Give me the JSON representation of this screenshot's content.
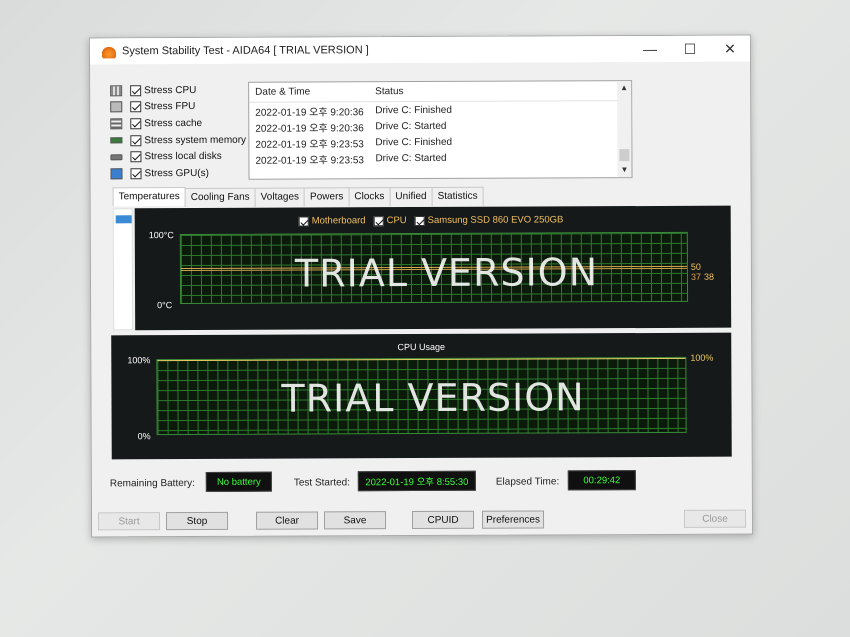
{
  "window": {
    "title": "System Stability Test - AIDA64  [ TRIAL VERSION ]",
    "controls": {
      "minimize": "—",
      "maximize": "☐",
      "close": "✕"
    }
  },
  "stress_options": [
    {
      "label": "Stress CPU",
      "icon": "cpu-icon",
      "checked": true
    },
    {
      "label": "Stress FPU",
      "icon": "fpu-icon",
      "checked": true
    },
    {
      "label": "Stress cache",
      "icon": "cache-icon",
      "checked": true
    },
    {
      "label": "Stress system memory",
      "icon": "memory-icon",
      "checked": true
    },
    {
      "label": "Stress local disks",
      "icon": "disk-icon",
      "checked": true
    },
    {
      "label": "Stress GPU(s)",
      "icon": "gpu-icon",
      "checked": true
    }
  ],
  "status_log": {
    "headers": {
      "datetime": "Date & Time",
      "status": "Status"
    },
    "rows": [
      {
        "datetime": "2022-01-19 오후 9:20:36",
        "status": "Drive C: Finished"
      },
      {
        "datetime": "2022-01-19 오후 9:20:36",
        "status": "Drive C: Started"
      },
      {
        "datetime": "2022-01-19 오후 9:23:53",
        "status": "Drive C: Finished"
      },
      {
        "datetime": "2022-01-19 오후 9:23:53",
        "status": "Drive C: Started"
      }
    ]
  },
  "tabs": [
    "Temperatures",
    "Cooling Fans",
    "Voltages",
    "Powers",
    "Clocks",
    "Unified",
    "Statistics"
  ],
  "temperature_chart": {
    "legend": [
      {
        "label": "Motherboard",
        "checked": true
      },
      {
        "label": "CPU",
        "checked": true
      },
      {
        "label": "Samsung SSD 860 EVO 250GB",
        "checked": true
      }
    ],
    "y_max_label": "100°C",
    "y_min_label": "0°C",
    "watermark": "TRIAL VERSION",
    "value_labels": {
      "top": "50",
      "bottom_a": "37",
      "bottom_b": "38"
    }
  },
  "cpu_chart": {
    "title": "CPU Usage",
    "y_max_label": "100%",
    "y_min_label": "0%",
    "watermark": "TRIAL VERSION",
    "value_label": "100%"
  },
  "chart_data": [
    {
      "type": "line",
      "title": "",
      "ylabel": "°C",
      "ylim": [
        0,
        100
      ],
      "series": [
        {
          "name": "Motherboard",
          "values": [
            37,
            37,
            37,
            37
          ]
        },
        {
          "name": "CPU",
          "values": [
            50,
            50,
            50,
            50
          ]
        },
        {
          "name": "Samsung SSD 860 EVO 250GB",
          "values": [
            38,
            38,
            38,
            38
          ]
        }
      ],
      "grid": true
    },
    {
      "type": "line",
      "title": "CPU Usage",
      "ylim": [
        0,
        100
      ],
      "series": [
        {
          "values": [
            100,
            100,
            100,
            100
          ]
        }
      ],
      "grid": true
    }
  ],
  "info": {
    "battery_label": "Remaining Battery:",
    "battery_value": "No battery",
    "started_label": "Test Started:",
    "started_value": "2022-01-19 오후 8:55:30",
    "elapsed_label": "Elapsed Time:",
    "elapsed_value": "00:29:42"
  },
  "buttons": {
    "start": "Start",
    "stop": "Stop",
    "clear": "Clear",
    "save": "Save",
    "cpuid": "CPUID",
    "preferences": "Preferences",
    "close": "Close"
  },
  "colors": {
    "graph_bg": "#16191a",
    "grid_line": "#2c7a2c",
    "temp_line": "#d6a850",
    "cpu_line": "#e8c860",
    "info_value_text": "#3cff3c"
  }
}
